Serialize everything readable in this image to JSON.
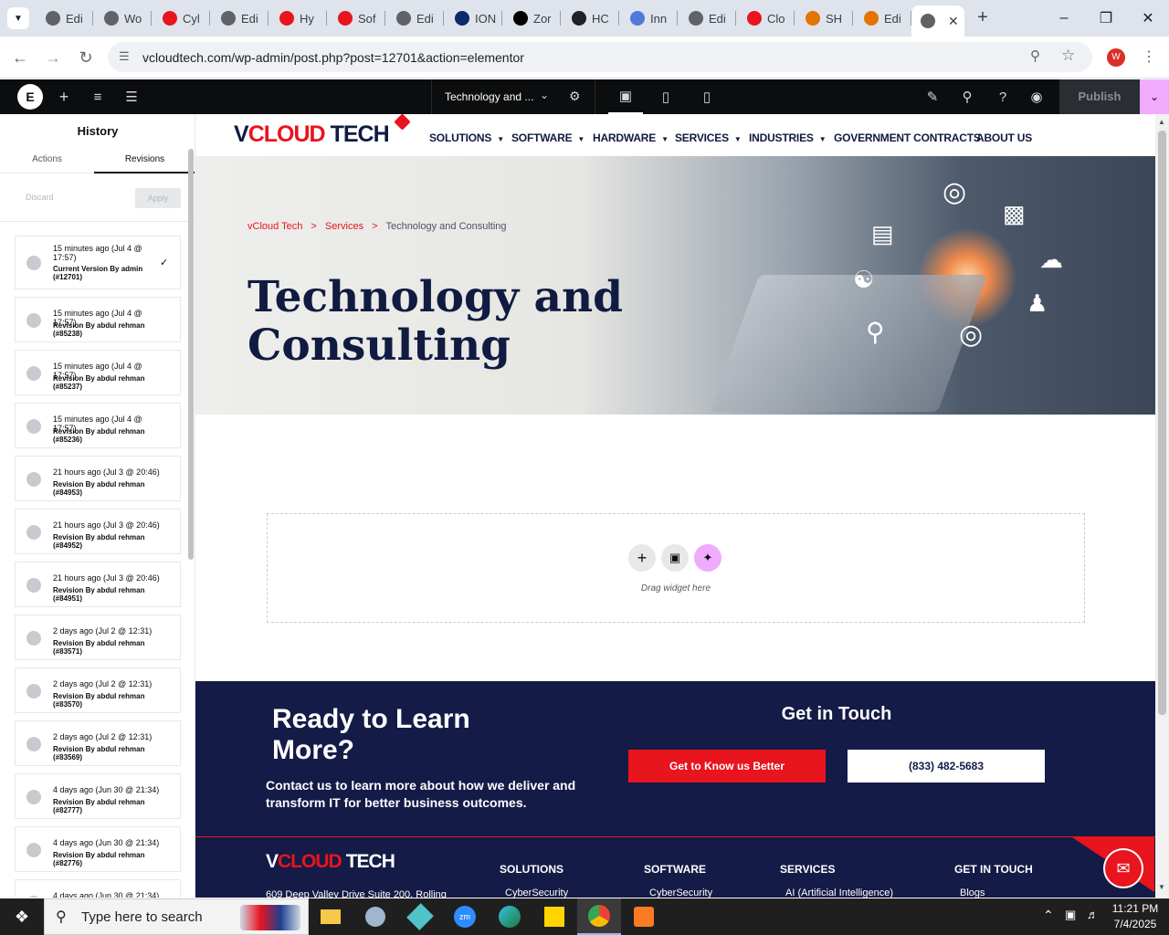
{
  "browser": {
    "tabs": [
      {
        "label": "Edi",
        "color": "#5f6368"
      },
      {
        "label": "Wo",
        "color": "#5f6368"
      },
      {
        "label": "Cyl",
        "color": "#e8141e"
      },
      {
        "label": "Edi",
        "color": "#5f6368"
      },
      {
        "label": "Hy",
        "color": "#e8141e"
      },
      {
        "label": "Sof",
        "color": "#e8141e"
      },
      {
        "label": "Edi",
        "color": "#5f6368"
      },
      {
        "label": "ION",
        "color": "#0a2a6b"
      },
      {
        "label": "Zor",
        "color": "#000000"
      },
      {
        "label": "HC",
        "color": "#202124"
      },
      {
        "label": "Inn",
        "color": "#4f7ad9"
      },
      {
        "label": "Edi",
        "color": "#5f6368"
      },
      {
        "label": "Clo",
        "color": "#e8141e"
      },
      {
        "label": "SH",
        "color": "#e37400"
      },
      {
        "label": "Edi",
        "color": "#e37400"
      }
    ],
    "new_tab_symbol": "+",
    "url": "vcloudtech.com/wp-admin/post.php?post=12701&action=elementor",
    "profile_initial": "W"
  },
  "elementor": {
    "page_title": "Technology and ...",
    "publish_label": "Publish"
  },
  "panel": {
    "title": "History",
    "tabs": [
      "Actions",
      "Revisions"
    ],
    "discard_label": "Discard",
    "apply_label": "Apply",
    "revisions": [
      {
        "time": "15 minutes ago (Jul 4 @ 17:57)",
        "meta": "Current Version By admin (#12701)",
        "current": true
      },
      {
        "time": "15 minutes ago (Jul 4 @ 17:57)",
        "meta": "Revision By abdul rehman (#85238)"
      },
      {
        "time": "15 minutes ago (Jul 4 @ 17:57)",
        "meta": "Revision By abdul rehman (#85237)"
      },
      {
        "time": "15 minutes ago (Jul 4 @ 17:57)",
        "meta": "Revision By abdul rehman (#85236)"
      },
      {
        "time": "21 hours ago (Jul 3 @ 20:46)",
        "meta": "Revision By abdul rehman (#84953)"
      },
      {
        "time": "21 hours ago (Jul 3 @ 20:46)",
        "meta": "Revision By abdul rehman (#84952)"
      },
      {
        "time": "21 hours ago (Jul 3 @ 20:46)",
        "meta": "Revision By abdul rehman (#84951)"
      },
      {
        "time": "2 days ago (Jul 2 @ 12:31)",
        "meta": "Revision By abdul rehman (#83571)"
      },
      {
        "time": "2 days ago (Jul 2 @ 12:31)",
        "meta": "Revision By abdul rehman (#83570)"
      },
      {
        "time": "2 days ago (Jul 2 @ 12:31)",
        "meta": "Revision By abdul rehman (#83569)"
      },
      {
        "time": "4 days ago (Jun 30 @ 21:34)",
        "meta": "Revision By abdul rehman (#82777)"
      },
      {
        "time": "4 days ago (Jun 30 @ 21:34)",
        "meta": "Revision By abdul rehman (#82776)"
      },
      {
        "time": "4 days ago (Jun 30 @ 21:34)",
        "meta": ""
      }
    ]
  },
  "site": {
    "logo": {
      "v": "V",
      "cloud": "CLOUD",
      "tech": "TECH"
    },
    "menu": [
      {
        "label": "SOLUTIONS",
        "dropdown": true
      },
      {
        "label": "SOFTWARE",
        "dropdown": true
      },
      {
        "label": "HARDWARE",
        "dropdown": true
      },
      {
        "label": "SERVICES",
        "dropdown": true
      },
      {
        "label": "INDUSTRIES",
        "dropdown": true
      },
      {
        "label": "GOVERNMENT CONTRACTS",
        "dropdown": false
      },
      {
        "label": "ABOUT US",
        "dropdown": false
      }
    ],
    "breadcrumb": [
      "vCloud Tech",
      ">",
      "Services",
      ">",
      "Technology and Consulting"
    ],
    "hero_title_line1": "Technology and",
    "hero_title_line2": "Consulting",
    "drag_hint": "Drag widget here",
    "cta": {
      "heading_line1": "Ready to Learn",
      "heading_line2": "More?",
      "text": "Contact us to learn more about how we deliver and transform IT for better business outcomes.",
      "get_in_touch": "Get in Touch",
      "button_primary": "Get to Know us Better",
      "button_phone": "(833) 482-5683"
    },
    "footer": {
      "address": "609 Deep Valley Drive Suite 200, Rolling",
      "columns": [
        {
          "heading": "SOLUTIONS",
          "first_item": "CyberSecurity"
        },
        {
          "heading": "SOFTWARE",
          "first_item": "CyberSecurity"
        },
        {
          "heading": "SERVICES",
          "first_item": "AI (Artificial Intelligence)"
        },
        {
          "heading": "GET IN TOUCH",
          "first_item": "Blogs"
        }
      ]
    },
    "colors": {
      "navy": "#141b47",
      "red": "#e8141e",
      "ink": "#0d1b4c"
    }
  },
  "taskbar": {
    "search_placeholder": "Type here to search",
    "time": "11:21 PM",
    "date": "7/4/2025"
  }
}
